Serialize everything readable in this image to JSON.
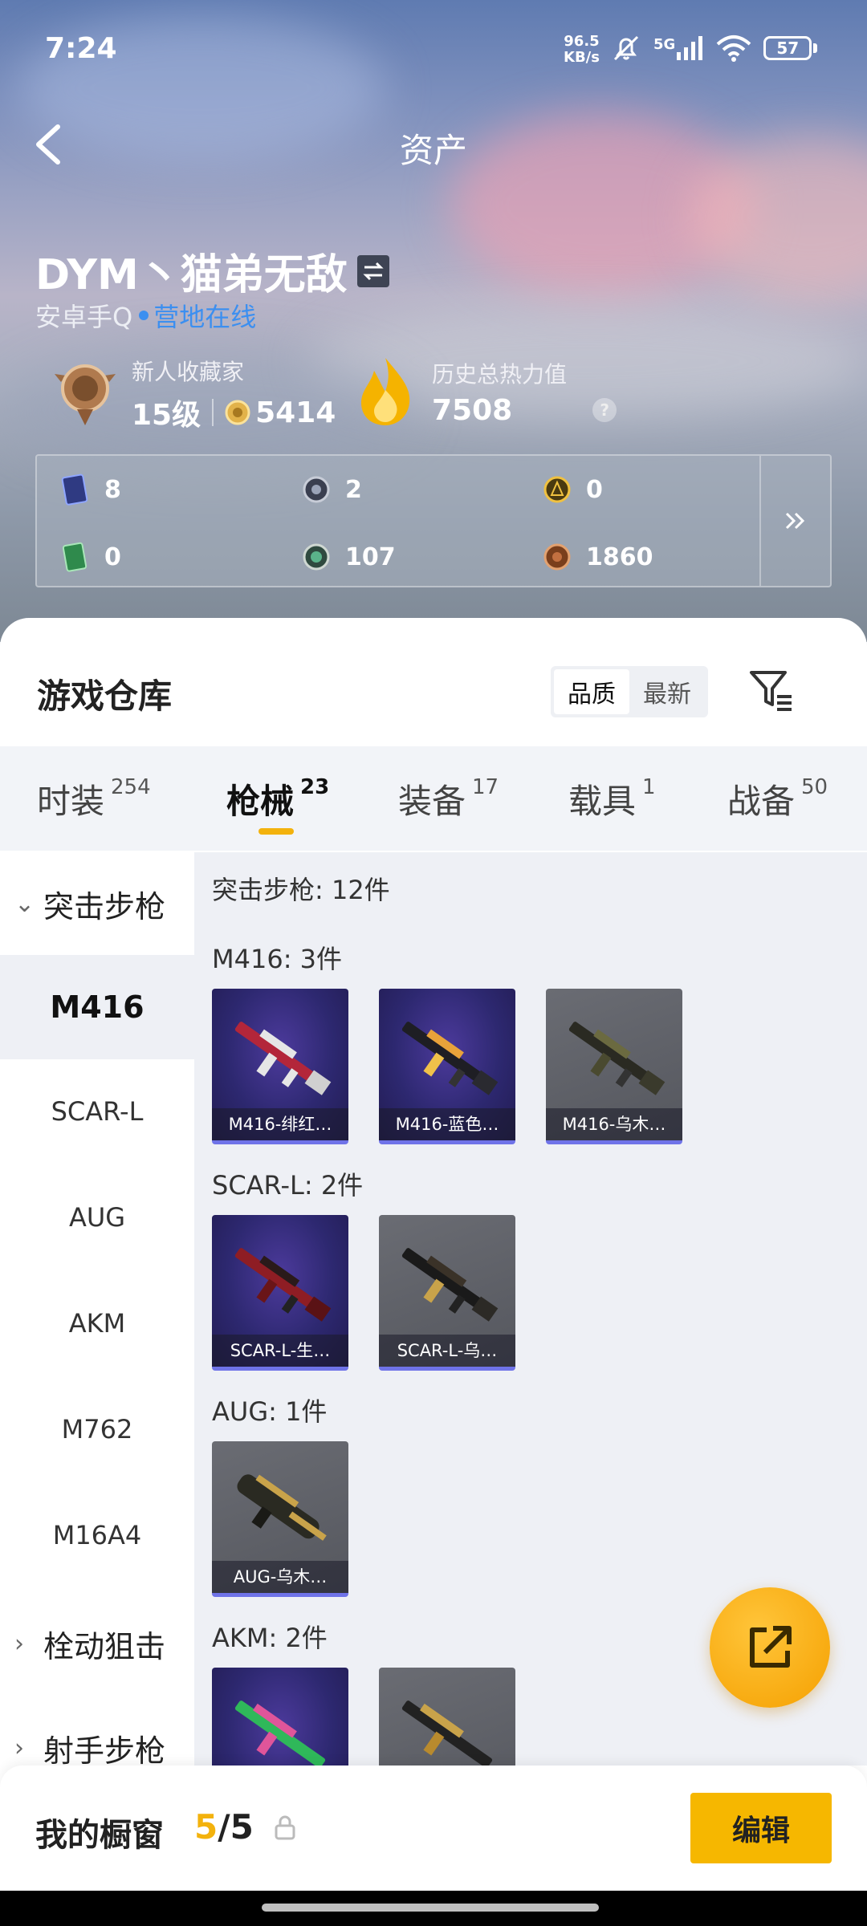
{
  "status_bar": {
    "time": "7:24",
    "speed_value": "96.5",
    "speed_unit": "KB/s",
    "network": "5G",
    "battery": "57"
  },
  "header": {
    "title": "资产"
  },
  "profile": {
    "name": "DYM丶猫弟无敌",
    "platform": "安卓手Q",
    "online_status": "营地在线",
    "collector_title": "新人收藏家",
    "level": "15级",
    "points": "5414",
    "heat_label": "历史总热力值",
    "heat_value": "7508",
    "help": "?"
  },
  "currencies": [
    {
      "icon": "card-icon",
      "value": "8"
    },
    {
      "icon": "coin-silver-icon",
      "value": "2"
    },
    {
      "icon": "coin-gold-icon",
      "value": "0"
    },
    {
      "icon": "ticket-icon",
      "value": "0"
    },
    {
      "icon": "orb-icon",
      "value": "107"
    },
    {
      "icon": "coin-bronze-icon",
      "value": "1860"
    }
  ],
  "warehouse": {
    "title": "游戏仓库",
    "sort_options": [
      "品质",
      "最新"
    ],
    "sort_selected": "品质"
  },
  "tabs": [
    {
      "label": "时装",
      "count": "254"
    },
    {
      "label": "枪械",
      "count": "23",
      "active": true
    },
    {
      "label": "装备",
      "count": "17"
    },
    {
      "label": "载具",
      "count": "1"
    },
    {
      "label": "战备",
      "count": "50"
    }
  ],
  "sidebar": {
    "categories": [
      "突击步枪",
      "栓动狙击",
      "射手步枪"
    ],
    "subs": [
      "M416",
      "SCAR-L",
      "AUG",
      "AKM",
      "M762",
      "M16A4"
    ],
    "selected": "M416"
  },
  "content": {
    "header": "突击步枪: 12件",
    "groups": [
      {
        "title": "M416: 3件",
        "items": [
          {
            "name": "M416-绯红…",
            "rarity": "purple"
          },
          {
            "name": "M416-蓝色…",
            "rarity": "purple"
          },
          {
            "name": "M416-乌木…",
            "rarity": "gray"
          }
        ]
      },
      {
        "title": "SCAR-L: 2件",
        "items": [
          {
            "name": "SCAR-L-生…",
            "rarity": "purple"
          },
          {
            "name": "SCAR-L-乌…",
            "rarity": "gray"
          }
        ]
      },
      {
        "title": "AUG: 1件",
        "items": [
          {
            "name": "AUG-乌木…",
            "rarity": "gray"
          }
        ]
      },
      {
        "title": "AKM: 2件",
        "items": [
          {
            "name": "",
            "rarity": "purple"
          },
          {
            "name": "",
            "rarity": "gray"
          }
        ]
      }
    ]
  },
  "showcase": {
    "label": "我的橱窗",
    "used": "5",
    "sep": "/",
    "total": "5",
    "edit_label": "编辑"
  },
  "colors": {
    "accent": "#f3b20d",
    "link": "#3c8ff0",
    "rare_purple": "#2d2870",
    "frame_gray": "#5d5f66"
  }
}
